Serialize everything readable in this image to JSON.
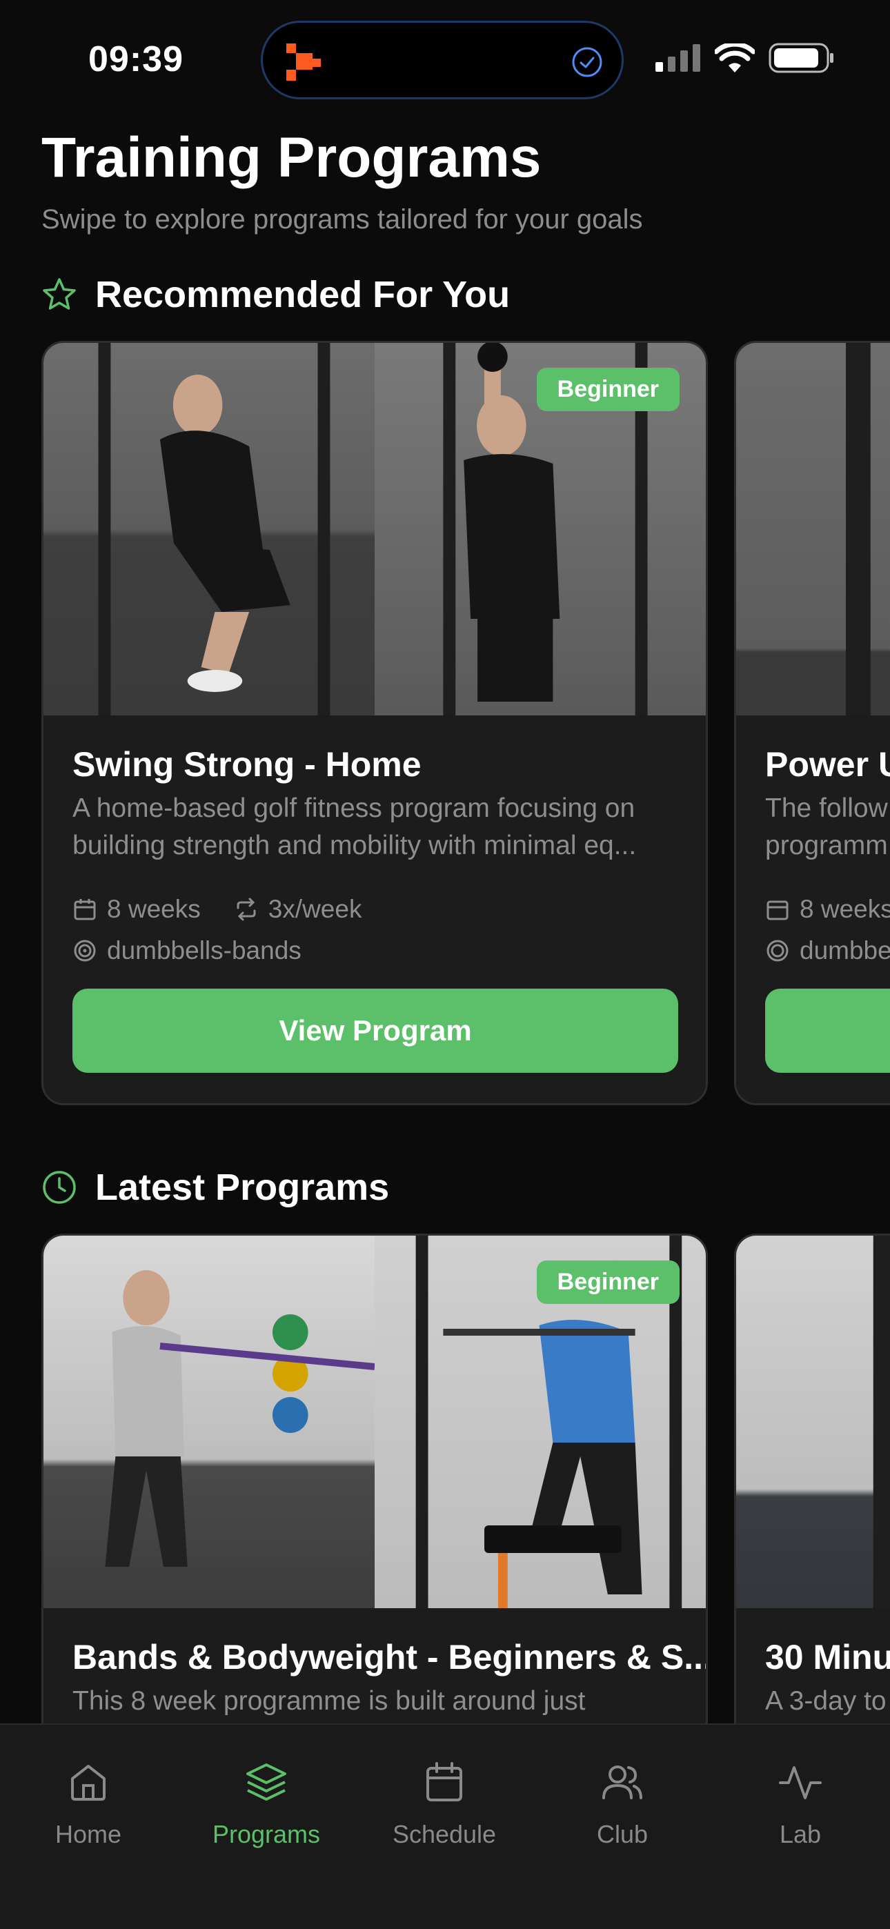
{
  "status_bar": {
    "time": "09:39"
  },
  "header": {
    "title": "Training Programs",
    "subtitle": "Swipe to explore programs tailored for your goals"
  },
  "recommended": {
    "heading": "Recommended For You",
    "cards": [
      {
        "badge": "Beginner",
        "name": "Swing Strong - Home",
        "description": "A home-based golf fitness program focusing on building strength and mobility with minimal eq...",
        "duration": "8 weeks",
        "frequency": "3x/week",
        "equipment": "dumbbells-bands",
        "button_label": "View Program"
      },
      {
        "name": "Power U",
        "description": "The follow programm",
        "duration": "8 weeks",
        "equipment": "dumbbe"
      }
    ]
  },
  "latest": {
    "heading": "Latest Programs",
    "cards": [
      {
        "badge": "Beginner",
        "name": "Bands & Bodyweight - Beginners & S...",
        "description": "This 8 week programme is built around just"
      },
      {
        "name": "30 Minu",
        "description": "A 3-day to"
      }
    ]
  },
  "tab_bar": {
    "tabs": [
      {
        "label": "Home",
        "icon": "home-icon"
      },
      {
        "label": "Programs",
        "icon": "layers-icon",
        "active": true
      },
      {
        "label": "Schedule",
        "icon": "calendar-icon"
      },
      {
        "label": "Club",
        "icon": "users-icon"
      },
      {
        "label": "Lab",
        "icon": "activity-icon"
      }
    ]
  },
  "colors": {
    "accent": "#5cc06a",
    "background": "#0b0b0b",
    "card": "#1c1c1c"
  }
}
